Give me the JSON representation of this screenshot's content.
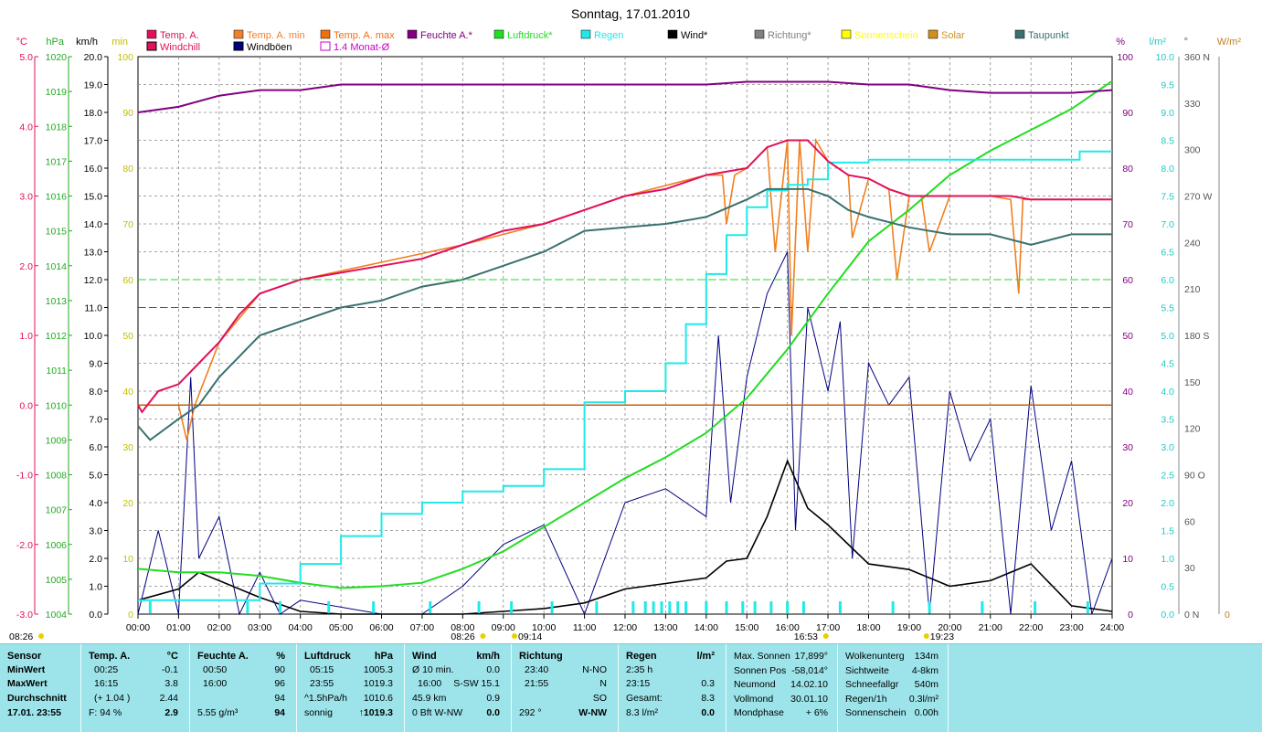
{
  "title": "Sonntag, 17.01.2010",
  "colors": {
    "temp": "#e0105a",
    "temp_min": "#f08020",
    "temp_max": "#f07010",
    "humidity": "#800080",
    "pressure": "#22dd22",
    "rain": "#22e8e8",
    "wind": "#000000",
    "gust": "#000080",
    "dew": "#3a7070",
    "solar": "#d09020",
    "monat": "#cc00cc"
  },
  "legend_row1": [
    {
      "label": "Temp. A.",
      "color": "#e0105a"
    },
    {
      "label": "Temp. A. min",
      "color": "#f08030"
    },
    {
      "label": "Temp. A. max",
      "color": "#f07010"
    },
    {
      "label": "Feuchte A.*",
      "color": "#800080"
    },
    {
      "label": "Luftdruck*",
      "color": "#22dd22"
    },
    {
      "label": "Regen",
      "color": "#22e8e8"
    },
    {
      "label": "Wind*",
      "color": "#000000"
    },
    {
      "label": "Richtung*",
      "color": "#808080"
    },
    {
      "label": "Sonnenschein",
      "color": "#ffff00"
    },
    {
      "label": "Solar",
      "color": "#d09020"
    },
    {
      "label": "Taupunkt",
      "color": "#3a7070"
    }
  ],
  "legend_row2": [
    {
      "label": "Windchill",
      "color": "#e0105a"
    },
    {
      "label": "Windböen",
      "color": "#000080"
    },
    {
      "label": "1.4 Monat-Ø",
      "color": "#cc00cc"
    }
  ],
  "axis_units": {
    "c": "°C",
    "hpa": "hPa",
    "kmh": "km/h",
    "min": "min",
    "pct": "%",
    "lm2": "l/m²",
    "deg": "°",
    "wm2": "W/m²"
  },
  "axes": {
    "c": [
      "5.0",
      "4.0",
      "3.0",
      "2.0",
      "1.0",
      "0.0",
      "-1.0",
      "-2.0",
      "-3.0"
    ],
    "hpa": [
      "1020",
      "1019",
      "1018",
      "1017",
      "1016",
      "1015",
      "1014",
      "1013",
      "1012",
      "1011",
      "1010",
      "1009",
      "1008",
      "1007",
      "1006",
      "1005",
      "1004"
    ],
    "kmh": [
      "20.0",
      "19.0",
      "18.0",
      "17.0",
      "16.0",
      "15.0",
      "14.0",
      "13.0",
      "12.0",
      "11.0",
      "10.0",
      "9.0",
      "8.0",
      "7.0",
      "6.0",
      "5.0",
      "4.0",
      "3.0",
      "2.0",
      "1.0",
      "0.0"
    ],
    "min": [
      "100",
      "90",
      "80",
      "70",
      "60",
      "50",
      "40",
      "30",
      "20",
      "10",
      "0"
    ],
    "pct": [
      "100",
      "90",
      "80",
      "70",
      "60",
      "50",
      "40",
      "30",
      "20",
      "10",
      "0"
    ],
    "lm2": [
      "10.0",
      "9.5",
      "9.0",
      "8.5",
      "8.0",
      "7.5",
      "7.0",
      "6.5",
      "6.0",
      "5.5",
      "5.0",
      "4.5",
      "4.0",
      "3.5",
      "3.0",
      "2.5",
      "2.0",
      "1.5",
      "1.0",
      "0.5",
      "0.0"
    ],
    "deg": [
      "360 N",
      "330",
      "300",
      "270 W",
      "240",
      "210",
      "180 S",
      "150",
      "120",
      "90  O",
      "60",
      "30",
      "0   N"
    ],
    "wm2": [
      "0"
    ],
    "time": [
      "00:00",
      "01:00",
      "02:00",
      "03:00",
      "04:00",
      "05:00",
      "06:00",
      "07:00",
      "08:00",
      "09:00",
      "10:00",
      "11:00",
      "12:00",
      "13:00",
      "14:00",
      "15:00",
      "16:00",
      "17:00",
      "18:00",
      "19:00",
      "20:00",
      "21:00",
      "22:00",
      "23:00",
      "24:00"
    ]
  },
  "sun_events": [
    "08:26",
    "09:14",
    "16:53",
    "19:23"
  ],
  "sun_left": "08:26",
  "chart_data": {
    "type": "line",
    "title": "Sonntag, 17.01.2010",
    "x_range": [
      "00:00",
      "24:00"
    ],
    "series": [
      {
        "name": "Temp. A.",
        "axis": "°C",
        "x": [
          0,
          0.1,
          0.5,
          1,
          1.5,
          2,
          2.5,
          3,
          3.5,
          4,
          5,
          6,
          7,
          8,
          9,
          10,
          11,
          12,
          13,
          14,
          15,
          15.5,
          16,
          16.5,
          17,
          17.5,
          18,
          18.5,
          19,
          20,
          21,
          21.5,
          22,
          23,
          24
        ],
        "y": [
          0,
          -0.1,
          0.2,
          0.3,
          0.6,
          0.9,
          1.3,
          1.6,
          1.7,
          1.8,
          1.9,
          2.0,
          2.1,
          2.3,
          2.5,
          2.6,
          2.8,
          3.0,
          3.1,
          3.3,
          3.4,
          3.7,
          3.8,
          3.8,
          3.5,
          3.3,
          3.25,
          3.1,
          3.0,
          3.0,
          3.0,
          3.0,
          2.95,
          2.95,
          2.95
        ]
      },
      {
        "name": "Feuchte A.*",
        "axis": "%",
        "x": [
          0,
          1,
          2,
          3,
          4,
          5,
          6,
          8,
          10,
          12,
          13,
          14,
          15,
          16,
          17,
          18,
          19,
          20,
          21,
          22,
          23,
          24
        ],
        "y": [
          90,
          91,
          93,
          94,
          94,
          95,
          95,
          95,
          95,
          95,
          95,
          95,
          95.5,
          95.5,
          95.5,
          95,
          95,
          94,
          93.5,
          93.5,
          93.5,
          94
        ]
      },
      {
        "name": "Luftdruck*",
        "axis": "hPa",
        "x": [
          0,
          1,
          2,
          3,
          4,
          5,
          6,
          7,
          8,
          9,
          10,
          11,
          12,
          13,
          14,
          15,
          16,
          17,
          18,
          19,
          20,
          21,
          22,
          23,
          24
        ],
        "y": [
          1005.3,
          1005.2,
          1005.2,
          1005.1,
          1004.9,
          1004.75,
          1004.8,
          1004.9,
          1005.3,
          1005.8,
          1006.5,
          1007.2,
          1007.9,
          1008.5,
          1009.2,
          1010.2,
          1011.6,
          1013.2,
          1014.7,
          1015.6,
          1016.6,
          1017.3,
          1017.9,
          1018.5,
          1019.3
        ]
      },
      {
        "name": "Regen",
        "axis": "l/m²",
        "x": [
          0,
          2.7,
          3,
          4,
          5,
          6,
          7,
          8,
          9,
          10,
          11,
          12,
          13,
          13.5,
          14,
          14.5,
          15,
          15.5,
          16,
          16.5,
          17,
          18,
          19,
          20,
          21,
          22,
          23,
          23.2,
          24
        ],
        "y": [
          0.25,
          0.25,
          0.55,
          0.9,
          1.4,
          1.8,
          2.0,
          2.2,
          2.3,
          2.6,
          3.8,
          4.0,
          4.5,
          5.2,
          6.1,
          6.8,
          7.3,
          7.6,
          7.7,
          7.8,
          8.1,
          8.15,
          8.15,
          8.15,
          8.15,
          8.15,
          8.15,
          8.3,
          8.3
        ]
      },
      {
        "name": "Taupunkt",
        "axis": "°C",
        "x": [
          0,
          0.3,
          1,
          1.5,
          2,
          2.5,
          3,
          3.5,
          4,
          5,
          6,
          7,
          8,
          9,
          10,
          11,
          12,
          13,
          14,
          15,
          15.5,
          16,
          16.5,
          17,
          17.5,
          18,
          19,
          20,
          21,
          22,
          23,
          24
        ],
        "y": [
          -0.3,
          -0.5,
          -0.2,
          0,
          0.4,
          0.7,
          1.0,
          1.1,
          1.2,
          1.4,
          1.5,
          1.7,
          1.8,
          2.0,
          2.2,
          2.5,
          2.55,
          2.6,
          2.7,
          2.95,
          3.1,
          3.1,
          3.1,
          3.0,
          2.8,
          2.7,
          2.55,
          2.45,
          2.45,
          2.3,
          2.45,
          2.45
        ]
      },
      {
        "name": "Wind*",
        "axis": "km/h",
        "x": [
          0,
          1,
          1.5,
          2,
          3,
          4,
          5,
          6,
          7,
          8,
          9,
          10,
          11,
          12,
          13,
          14,
          14.5,
          15,
          15.5,
          16,
          16.5,
          17,
          18,
          19,
          20,
          21,
          22,
          23,
          24
        ],
        "y": [
          0.5,
          0.9,
          1.5,
          1.2,
          0.6,
          0.1,
          0,
          0,
          0,
          0,
          0.1,
          0.2,
          0.4,
          0.9,
          1.1,
          1.3,
          1.9,
          2.0,
          3.5,
          5.5,
          3.8,
          3.2,
          1.8,
          1.6,
          1.0,
          1.2,
          1.8,
          0.3,
          0.1
        ]
      },
      {
        "name": "Windböen",
        "axis": "km/h",
        "x": [
          0,
          0.5,
          1,
          1.3,
          1.5,
          2,
          2.5,
          3,
          3.5,
          4,
          6,
          7,
          8,
          9,
          10,
          11,
          12,
          13,
          14,
          14.3,
          14.6,
          15,
          15.5,
          16,
          16.2,
          16.5,
          17,
          17.3,
          17.6,
          18,
          18.5,
          19,
          19.5,
          20,
          20.5,
          21,
          21.5,
          22,
          22.5,
          23,
          23.5,
          24
        ],
        "y": [
          0,
          3.0,
          0,
          8.5,
          2.0,
          3.5,
          0,
          1.5,
          0,
          0.5,
          0,
          0,
          1.0,
          2.5,
          3.2,
          0,
          4.0,
          4.5,
          3.5,
          10.0,
          4.0,
          8.5,
          11.5,
          13.0,
          3.0,
          11.0,
          8.0,
          10.5,
          2.0,
          9.0,
          7.5,
          8.5,
          0,
          8.0,
          5.5,
          7.0,
          0,
          8.2,
          3.0,
          5.5,
          0,
          2.0
        ]
      },
      {
        "name": "Windchill",
        "axis": "°C",
        "x": [
          0,
          1,
          1.2,
          1.4,
          2,
          3,
          4,
          8,
          10,
          12,
          14,
          14.4,
          14.5,
          14.7,
          15,
          15.5,
          15.7,
          16,
          16.1,
          16.3,
          16.5,
          16.7,
          17,
          17.5,
          17.6,
          18,
          18.5,
          18.7,
          19,
          19.3,
          19.5,
          20,
          21,
          21.5,
          21.7,
          21.8,
          22,
          23,
          24
        ],
        "y": [
          0,
          0,
          -0.5,
          0,
          0.9,
          1.6,
          1.8,
          2.3,
          2.6,
          3.0,
          3.3,
          3.3,
          2.6,
          3.3,
          3.4,
          3.7,
          2.2,
          3.8,
          1.0,
          3.8,
          2.2,
          3.8,
          3.5,
          3.3,
          2.4,
          3.25,
          3.1,
          1.8,
          3.0,
          3.0,
          2.2,
          3.0,
          3.0,
          2.95,
          1.6,
          2.95,
          2.95,
          2.95,
          2.95
        ]
      },
      {
        "name": "Temp. A. max",
        "axis": "°C",
        "x": [
          0,
          24
        ],
        "y": [
          0,
          0
        ]
      },
      {
        "name": "1.4 Monat-Ø",
        "axis": "%",
        "x": [
          0,
          24
        ],
        "y": [
          55,
          55
        ]
      }
    ]
  },
  "panel": {
    "sensor": {
      "h": "Sensor",
      "rows": [
        "MinWert",
        "MaxWert",
        "Durchschnitt",
        "17.01. 23:55"
      ]
    },
    "temp": {
      "h": "Temp. A.",
      "u": "°C",
      "rows": [
        [
          "00:25",
          "-0.1"
        ],
        [
          "16:15",
          "3.8"
        ],
        [
          "(+ 1.04 )",
          "2.44"
        ],
        [
          "F: 94 %",
          "2.9"
        ]
      ]
    },
    "hum": {
      "h": "Feuchte A.",
      "u": "%",
      "rows": [
        [
          "00:50",
          "90"
        ],
        [
          "16:00",
          "96"
        ],
        [
          "",
          "94"
        ],
        [
          "5.55 g/m³",
          "94"
        ]
      ]
    },
    "press": {
      "h": "Luftdruck",
      "u": "hPa",
      "rows": [
        [
          "05:15",
          "1005.3"
        ],
        [
          "23:55",
          "1019.3"
        ],
        [
          "^1.5hPa/h",
          "1010.6"
        ],
        [
          "sonnig",
          "↑1019.3"
        ]
      ]
    },
    "wind": {
      "h": "Wind",
      "u": "km/h",
      "rows": [
        [
          "Ø 10 min.",
          "",
          "0.0"
        ],
        [
          "16:00",
          "S-SW 15.1",
          ""
        ],
        [
          "45.9 km",
          "",
          "0.9"
        ],
        [
          "0 Bft W-NW",
          "",
          "0.0"
        ]
      ]
    },
    "dir": {
      "h": "Richtung",
      "rows": [
        [
          "23:40",
          "N-NO"
        ],
        [
          "21:55",
          "N"
        ],
        [
          "",
          "SO"
        ],
        [
          "292 °",
          "W-NW"
        ]
      ]
    },
    "rain": {
      "h": "Regen",
      "u": "l/m²",
      "rows": [
        [
          "2:35 h",
          ""
        ],
        [
          "23:15",
          "0.3"
        ],
        [
          "Gesamt:",
          "8.3"
        ],
        [
          "8.3 l/m²",
          "0.0"
        ]
      ]
    },
    "astro": {
      "rows": [
        [
          "Max. Sonnen",
          "17,899°"
        ],
        [
          "Sonnen Pos",
          "-58,014°"
        ],
        [
          "Neumond",
          "14.02.10"
        ],
        [
          "Vollmond",
          "30.01.10"
        ],
        [
          "Mondphase",
          "+ 6%"
        ]
      ]
    },
    "misc": {
      "rows": [
        [
          "Wolkenunterg",
          "134m"
        ],
        [
          "Sichtweite",
          "4-8km"
        ],
        [
          "Schneefallgr",
          "540m"
        ],
        [
          "Regen/1h",
          "0.3l/m²"
        ],
        [
          "Sonnenschein",
          "0.00h"
        ]
      ]
    }
  }
}
